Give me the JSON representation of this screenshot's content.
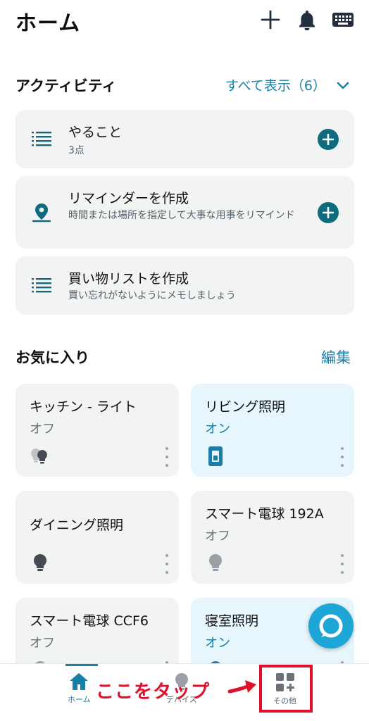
{
  "header": {
    "title": "ホーム",
    "icons": [
      "plus-icon",
      "bell-icon",
      "keyboard-icon"
    ]
  },
  "activity": {
    "title": "アクティビティ",
    "show_all": "すべて表示（6）",
    "items": [
      {
        "title": "やること",
        "subtitle": "3点",
        "icon": "list-icon",
        "has_add": true
      },
      {
        "title": "リマインダーを作成",
        "subtitle": "時間または場所を指定して大事な用事をリマインド",
        "icon": "location-pin-icon",
        "has_add": true
      },
      {
        "title": "買い物リストを作成",
        "subtitle": "買い忘れがないようにメモしましょう",
        "icon": "list-icon",
        "has_add": false
      }
    ]
  },
  "favorites": {
    "title": "お気に入り",
    "edit": "編集",
    "devices": [
      {
        "name": "キッチン - ライト",
        "state": "オフ",
        "on": false,
        "icon": "bulb-group-icon"
      },
      {
        "name": "リビング照明",
        "state": "オン",
        "on": true,
        "icon": "switch-icon"
      },
      {
        "name": "ダイニング照明",
        "state": "",
        "on": false,
        "icon": "bulb-icon"
      },
      {
        "name": "スマート電球 192A",
        "state": "オフ",
        "on": false,
        "icon": "bulb-icon"
      },
      {
        "name": "スマート電球 CCF6",
        "state": "オフ",
        "on": false,
        "icon": "bulb-icon"
      },
      {
        "name": "寝室照明",
        "state": "オン",
        "on": true,
        "icon": "bulb-icon"
      }
    ]
  },
  "bottom_nav": {
    "items": [
      {
        "label": "ホーム",
        "icon": "home-icon",
        "active": true
      },
      {
        "label": "デバイス",
        "icon": "bulb-icon",
        "active": false
      },
      {
        "label": "その他",
        "icon": "more-grid-icon",
        "active": false
      }
    ]
  },
  "annotation": {
    "text": "ここをタップ",
    "color": "#e0102a"
  },
  "colors": {
    "accent": "#1a7fa8",
    "teal": "#0d6b7d",
    "card_bg": "#f2f3f3",
    "card_on_bg": "#e6f6fc",
    "alexa_blue": "#1ea7d6"
  }
}
